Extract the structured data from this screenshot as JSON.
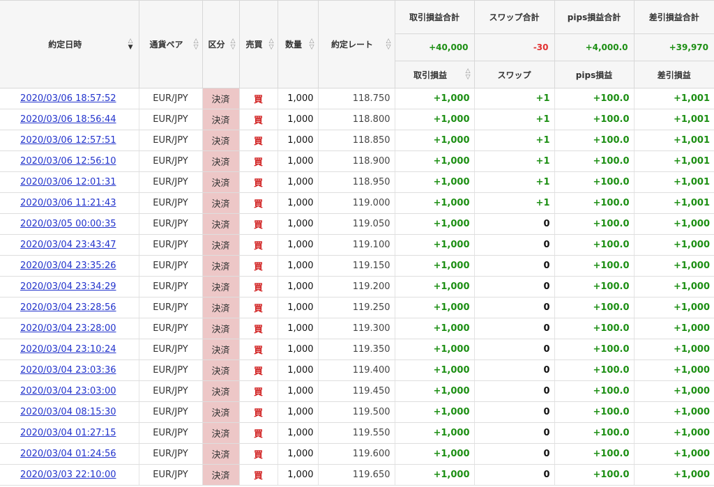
{
  "headers": {
    "date": "約定日時",
    "pair": "通貨ペア",
    "type": "区分",
    "side": "売買",
    "qty": "数量",
    "rate": "約定レート",
    "trade_pl": "取引損益",
    "swap": "スワップ",
    "pips_pl": "pips損益",
    "net_pl": "差引損益"
  },
  "totals": {
    "trade_pl_label": "取引損益合計",
    "swap_label": "スワップ合計",
    "pips_label": "pips損益合計",
    "net_label": "差引損益合計",
    "trade_pl": "+40,000",
    "swap": "-30",
    "pips": "+4,000.0",
    "net": "+39,970"
  },
  "sort_icons": {
    "up": "sort-up-icon",
    "down": "sort-down-icon",
    "active_column": "date",
    "active_direction": "desc"
  },
  "colors": {
    "positive": "#1d8f14",
    "negative": "#d12020",
    "settle_bg": "#edc7c7",
    "link": "#2233cc"
  },
  "rows": [
    {
      "date": "2020/03/06 18:57:52",
      "pair": "EUR/JPY",
      "type": "決済",
      "side": "買",
      "qty": "1,000",
      "rate": "118.750",
      "trade_pl": "+1,000",
      "swap": "+1",
      "pips": "+100.0",
      "net": "+1,001"
    },
    {
      "date": "2020/03/06 18:56:44",
      "pair": "EUR/JPY",
      "type": "決済",
      "side": "買",
      "qty": "1,000",
      "rate": "118.800",
      "trade_pl": "+1,000",
      "swap": "+1",
      "pips": "+100.0",
      "net": "+1,001"
    },
    {
      "date": "2020/03/06 12:57:51",
      "pair": "EUR/JPY",
      "type": "決済",
      "side": "買",
      "qty": "1,000",
      "rate": "118.850",
      "trade_pl": "+1,000",
      "swap": "+1",
      "pips": "+100.0",
      "net": "+1,001"
    },
    {
      "date": "2020/03/06 12:56:10",
      "pair": "EUR/JPY",
      "type": "決済",
      "side": "買",
      "qty": "1,000",
      "rate": "118.900",
      "trade_pl": "+1,000",
      "swap": "+1",
      "pips": "+100.0",
      "net": "+1,001"
    },
    {
      "date": "2020/03/06 12:01:31",
      "pair": "EUR/JPY",
      "type": "決済",
      "side": "買",
      "qty": "1,000",
      "rate": "118.950",
      "trade_pl": "+1,000",
      "swap": "+1",
      "pips": "+100.0",
      "net": "+1,001"
    },
    {
      "date": "2020/03/06 11:21:43",
      "pair": "EUR/JPY",
      "type": "決済",
      "side": "買",
      "qty": "1,000",
      "rate": "119.000",
      "trade_pl": "+1,000",
      "swap": "+1",
      "pips": "+100.0",
      "net": "+1,001"
    },
    {
      "date": "2020/03/05 00:00:35",
      "pair": "EUR/JPY",
      "type": "決済",
      "side": "買",
      "qty": "1,000",
      "rate": "119.050",
      "trade_pl": "+1,000",
      "swap": "0",
      "pips": "+100.0",
      "net": "+1,000"
    },
    {
      "date": "2020/03/04 23:43:47",
      "pair": "EUR/JPY",
      "type": "決済",
      "side": "買",
      "qty": "1,000",
      "rate": "119.100",
      "trade_pl": "+1,000",
      "swap": "0",
      "pips": "+100.0",
      "net": "+1,000"
    },
    {
      "date": "2020/03/04 23:35:26",
      "pair": "EUR/JPY",
      "type": "決済",
      "side": "買",
      "qty": "1,000",
      "rate": "119.150",
      "trade_pl": "+1,000",
      "swap": "0",
      "pips": "+100.0",
      "net": "+1,000"
    },
    {
      "date": "2020/03/04 23:34:29",
      "pair": "EUR/JPY",
      "type": "決済",
      "side": "買",
      "qty": "1,000",
      "rate": "119.200",
      "trade_pl": "+1,000",
      "swap": "0",
      "pips": "+100.0",
      "net": "+1,000"
    },
    {
      "date": "2020/03/04 23:28:56",
      "pair": "EUR/JPY",
      "type": "決済",
      "side": "買",
      "qty": "1,000",
      "rate": "119.250",
      "trade_pl": "+1,000",
      "swap": "0",
      "pips": "+100.0",
      "net": "+1,000"
    },
    {
      "date": "2020/03/04 23:28:00",
      "pair": "EUR/JPY",
      "type": "決済",
      "side": "買",
      "qty": "1,000",
      "rate": "119.300",
      "trade_pl": "+1,000",
      "swap": "0",
      "pips": "+100.0",
      "net": "+1,000"
    },
    {
      "date": "2020/03/04 23:10:24",
      "pair": "EUR/JPY",
      "type": "決済",
      "side": "買",
      "qty": "1,000",
      "rate": "119.350",
      "trade_pl": "+1,000",
      "swap": "0",
      "pips": "+100.0",
      "net": "+1,000"
    },
    {
      "date": "2020/03/04 23:03:36",
      "pair": "EUR/JPY",
      "type": "決済",
      "side": "買",
      "qty": "1,000",
      "rate": "119.400",
      "trade_pl": "+1,000",
      "swap": "0",
      "pips": "+100.0",
      "net": "+1,000"
    },
    {
      "date": "2020/03/04 23:03:00",
      "pair": "EUR/JPY",
      "type": "決済",
      "side": "買",
      "qty": "1,000",
      "rate": "119.450",
      "trade_pl": "+1,000",
      "swap": "0",
      "pips": "+100.0",
      "net": "+1,000"
    },
    {
      "date": "2020/03/04 08:15:30",
      "pair": "EUR/JPY",
      "type": "決済",
      "side": "買",
      "qty": "1,000",
      "rate": "119.500",
      "trade_pl": "+1,000",
      "swap": "0",
      "pips": "+100.0",
      "net": "+1,000"
    },
    {
      "date": "2020/03/04 01:27:15",
      "pair": "EUR/JPY",
      "type": "決済",
      "side": "買",
      "qty": "1,000",
      "rate": "119.550",
      "trade_pl": "+1,000",
      "swap": "0",
      "pips": "+100.0",
      "net": "+1,000"
    },
    {
      "date": "2020/03/04 01:24:56",
      "pair": "EUR/JPY",
      "type": "決済",
      "side": "買",
      "qty": "1,000",
      "rate": "119.600",
      "trade_pl": "+1,000",
      "swap": "0",
      "pips": "+100.0",
      "net": "+1,000"
    },
    {
      "date": "2020/03/03 22:10:00",
      "pair": "EUR/JPY",
      "type": "決済",
      "side": "買",
      "qty": "1,000",
      "rate": "119.650",
      "trade_pl": "+1,000",
      "swap": "0",
      "pips": "+100.0",
      "net": "+1,000"
    }
  ]
}
